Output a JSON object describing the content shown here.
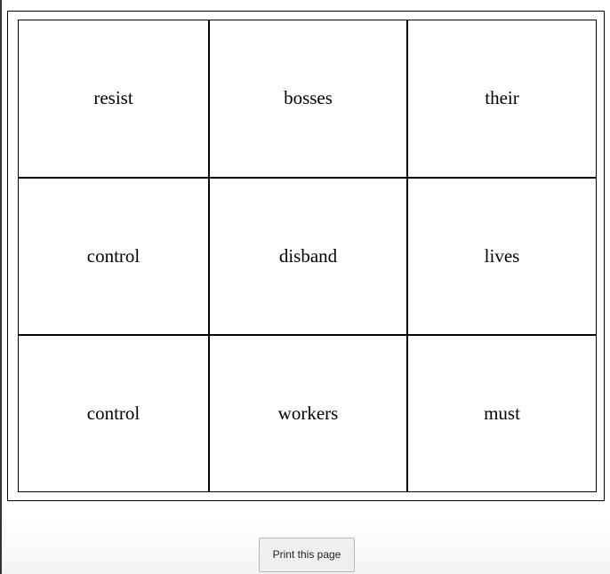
{
  "grid": {
    "rows": [
      [
        "resist",
        "bosses",
        "their"
      ],
      [
        "control",
        "disband",
        "lives"
      ],
      [
        "control",
        "workers",
        "must"
      ]
    ]
  },
  "actions": {
    "print_label": "Print this page"
  }
}
